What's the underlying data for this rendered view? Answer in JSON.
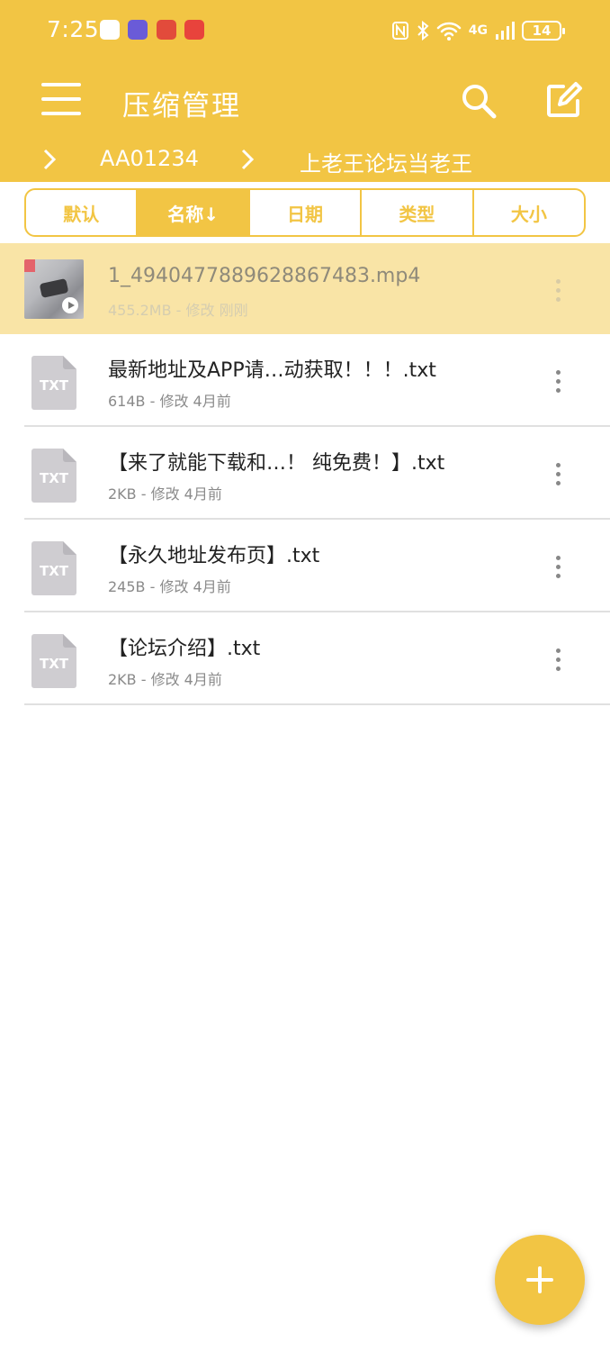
{
  "status": {
    "time": "7:25",
    "network": "4G",
    "battery": "14"
  },
  "appbar": {
    "title": "压缩管理"
  },
  "breadcrumb": {
    "items": [
      "AA01234",
      "上老王论坛当老王"
    ]
  },
  "sort": {
    "tabs": [
      "默认",
      "名称↓",
      "日期",
      "类型",
      "大小"
    ],
    "active_index": 1
  },
  "files": [
    {
      "name": "1_4940477889628867483.mp4",
      "meta": "455.2MB - 修改 刚刚",
      "type": "video",
      "selected": true
    },
    {
      "name": "最新地址及APP请…动获取！！！.txt",
      "meta": "614B - 修改 4月前",
      "type": "txt"
    },
    {
      "name": "【来了就能下载和…！ 纯免费！】.txt",
      "meta": "2KB - 修改 4月前",
      "type": "txt"
    },
    {
      "name": "【永久地址发布页】.txt",
      "meta": "245B - 修改 4月前",
      "type": "txt"
    },
    {
      "name": "【论坛介绍】.txt",
      "meta": "2KB - 修改 4月前",
      "type": "txt"
    }
  ],
  "icons": {
    "txt_label": "TXT"
  },
  "colors": {
    "accent": "#F2C544",
    "selected_row": "#F9E4A6"
  }
}
